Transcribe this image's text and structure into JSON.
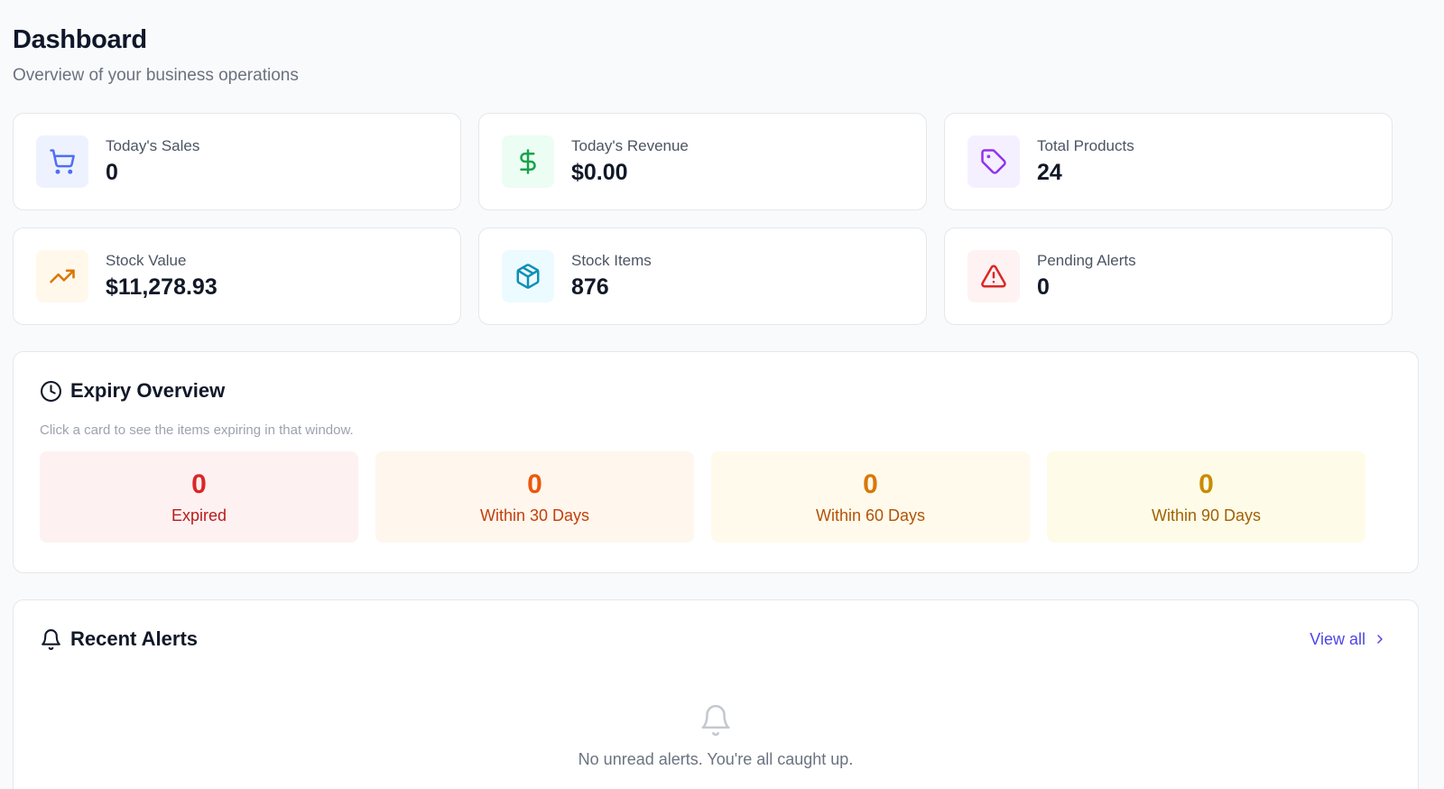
{
  "header": {
    "title": "Dashboard",
    "subtitle": "Overview of your business operations"
  },
  "stats": [
    {
      "label": "Today's Sales",
      "value": "0",
      "icon": "shopping-cart-icon",
      "icon_color": "#4f6ef7",
      "icon_bg": "#eef2ff"
    },
    {
      "label": "Today's Revenue",
      "value": "$0.00",
      "icon": "dollar-icon",
      "icon_color": "#16a34a",
      "icon_bg": "#ecfdf3"
    },
    {
      "label": "Total Products",
      "value": "24",
      "icon": "tag-icon",
      "icon_color": "#9333ea",
      "icon_bg": "#f5f0ff"
    },
    {
      "label": "Stock Value",
      "value": "$11,278.93",
      "icon": "trending-up-icon",
      "icon_color": "#d97706",
      "icon_bg": "#fff8eb"
    },
    {
      "label": "Stock Items",
      "value": "876",
      "icon": "box-icon",
      "icon_color": "#0e8fb8",
      "icon_bg": "#ecfbff"
    },
    {
      "label": "Pending Alerts",
      "value": "0",
      "icon": "alert-triangle-icon",
      "icon_color": "#dc2626",
      "icon_bg": "#fef2f2"
    }
  ],
  "expiry": {
    "title": "Expiry Overview",
    "hint": "Click a card to see the items expiring in that window.",
    "cards": [
      {
        "count": "0",
        "label": "Expired",
        "count_color": "#dc2626",
        "label_color": "#b91c1c",
        "bg": "#fdf1f1"
      },
      {
        "count": "0",
        "label": "Within 30 Days",
        "count_color": "#ea580c",
        "label_color": "#c2410c",
        "bg": "#fff6ee"
      },
      {
        "count": "0",
        "label": "Within 60 Days",
        "count_color": "#d97706",
        "label_color": "#b45309",
        "bg": "#fffaeb"
      },
      {
        "count": "0",
        "label": "Within 90 Days",
        "count_color": "#ca8a04",
        "label_color": "#a16207",
        "bg": "#fefce8"
      }
    ]
  },
  "alerts": {
    "title": "Recent Alerts",
    "view_all": "View all",
    "empty_text": "No unread alerts. You're all caught up."
  },
  "colors": {
    "accent": "#4f46e5",
    "muted": "#9ca3af"
  }
}
